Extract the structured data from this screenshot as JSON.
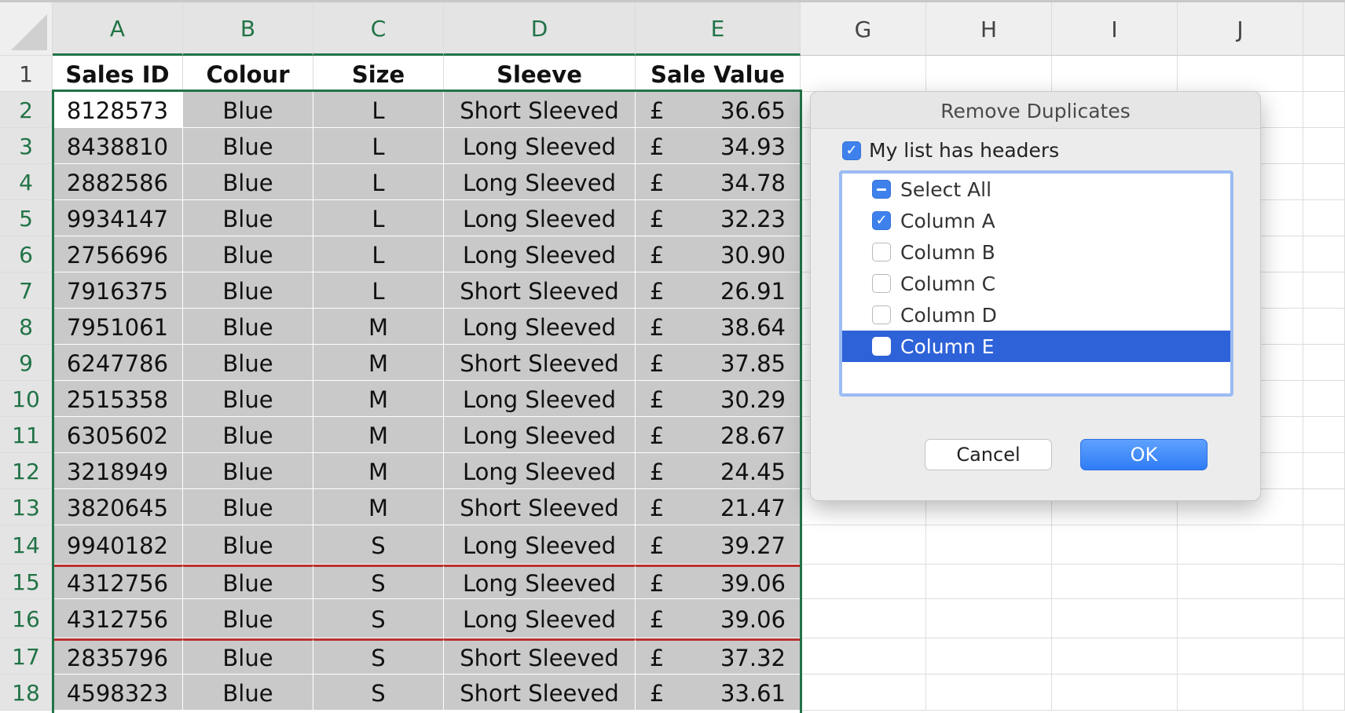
{
  "columns": [
    "A",
    "B",
    "C",
    "D",
    "E",
    "G",
    "H",
    "I",
    "J"
  ],
  "header_row": {
    "row_number": "1",
    "cells": [
      "Sales ID",
      "Colour",
      "Size",
      "Sleeve",
      "Sale Value"
    ]
  },
  "rows": [
    {
      "n": "2",
      "id": "8128573",
      "colour": "Blue",
      "size": "L",
      "sleeve": "Short Sleeved",
      "cur": "£",
      "value": "36.65"
    },
    {
      "n": "3",
      "id": "8438810",
      "colour": "Blue",
      "size": "L",
      "sleeve": "Long Sleeved",
      "cur": "£",
      "value": "34.93"
    },
    {
      "n": "4",
      "id": "2882586",
      "colour": "Blue",
      "size": "L",
      "sleeve": "Long Sleeved",
      "cur": "£",
      "value": "34.78"
    },
    {
      "n": "5",
      "id": "9934147",
      "colour": "Blue",
      "size": "L",
      "sleeve": "Long Sleeved",
      "cur": "£",
      "value": "32.23"
    },
    {
      "n": "6",
      "id": "2756696",
      "colour": "Blue",
      "size": "L",
      "sleeve": "Long Sleeved",
      "cur": "£",
      "value": "30.90"
    },
    {
      "n": "7",
      "id": "7916375",
      "colour": "Blue",
      "size": "L",
      "sleeve": "Short Sleeved",
      "cur": "£",
      "value": "26.91"
    },
    {
      "n": "8",
      "id": "7951061",
      "colour": "Blue",
      "size": "M",
      "sleeve": "Long Sleeved",
      "cur": "£",
      "value": "38.64"
    },
    {
      "n": "9",
      "id": "6247786",
      "colour": "Blue",
      "size": "M",
      "sleeve": "Short Sleeved",
      "cur": "£",
      "value": "37.85"
    },
    {
      "n": "10",
      "id": "2515358",
      "colour": "Blue",
      "size": "M",
      "sleeve": "Long Sleeved",
      "cur": "£",
      "value": "30.29"
    },
    {
      "n": "11",
      "id": "6305602",
      "colour": "Blue",
      "size": "M",
      "sleeve": "Long Sleeved",
      "cur": "£",
      "value": "28.67"
    },
    {
      "n": "12",
      "id": "3218949",
      "colour": "Blue",
      "size": "M",
      "sleeve": "Long Sleeved",
      "cur": "£",
      "value": "24.45"
    },
    {
      "n": "13",
      "id": "3820645",
      "colour": "Blue",
      "size": "M",
      "sleeve": "Short Sleeved",
      "cur": "£",
      "value": "21.47"
    },
    {
      "n": "14",
      "id": "9940182",
      "colour": "Blue",
      "size": "S",
      "sleeve": "Long Sleeved",
      "cur": "£",
      "value": "39.27"
    },
    {
      "n": "15",
      "id": "4312756",
      "colour": "Blue",
      "size": "S",
      "sleeve": "Long Sleeved",
      "cur": "£",
      "value": "39.06"
    },
    {
      "n": "16",
      "id": "4312756",
      "colour": "Blue",
      "size": "S",
      "sleeve": "Long Sleeved",
      "cur": "£",
      "value": "39.06"
    },
    {
      "n": "17",
      "id": "2835796",
      "colour": "Blue",
      "size": "S",
      "sleeve": "Short Sleeved",
      "cur": "£",
      "value": "37.32"
    },
    {
      "n": "18",
      "id": "4598323",
      "colour": "Blue",
      "size": "S",
      "sleeve": "Short Sleeved",
      "cur": "£",
      "value": "33.61"
    }
  ],
  "highlight_color": "#b8312f",
  "selection_color": "#217346",
  "dialog": {
    "title": "Remove Duplicates",
    "headers_label": "My list has headers",
    "headers_checked": true,
    "items": [
      {
        "label": "Select All",
        "state": "mixed"
      },
      {
        "label": "Column A",
        "state": "checked"
      },
      {
        "label": "Column B",
        "state": "unchecked"
      },
      {
        "label": "Column C",
        "state": "unchecked"
      },
      {
        "label": "Column D",
        "state": "unchecked"
      },
      {
        "label": "Column E",
        "state": "unchecked",
        "selected": true
      }
    ],
    "cancel_label": "Cancel",
    "ok_label": "OK"
  }
}
